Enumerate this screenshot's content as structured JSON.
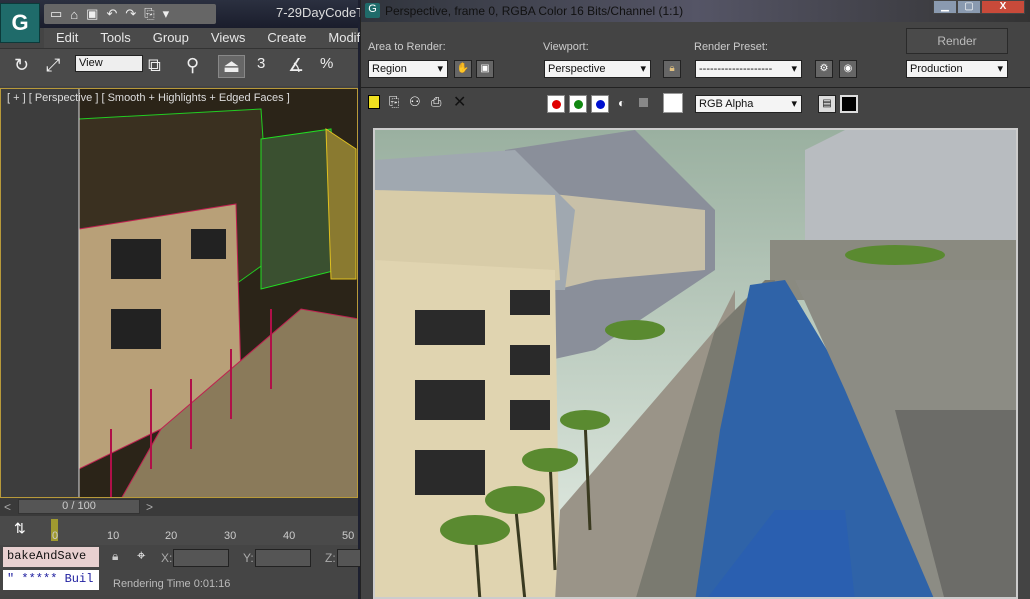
{
  "app": {
    "logo": "G",
    "document_title": "7-29DayCodeT",
    "quick_access": [
      "new-icon",
      "open-icon",
      "save-icon",
      "undo-icon",
      "redo-icon",
      "project-icon",
      "more-icon"
    ],
    "menu": [
      "Edit",
      "Tools",
      "Group",
      "Views",
      "Create",
      "Modifi"
    ],
    "toolbar": {
      "view_select": "View",
      "snap_label": "3",
      "percent_label": "%"
    },
    "viewport": {
      "label": "[ + ] [ Perspective ] [ Smooth + Highlights + Edged Faces ]"
    },
    "timeline": {
      "frame": "0 / 100",
      "prev": "<",
      "next": ">",
      "ticks": [
        "0",
        "10",
        "20",
        "30",
        "40",
        "50"
      ]
    },
    "script": {
      "listener_input": "bakeAndSave",
      "listener_output": "\" ***** Buil"
    },
    "coords": {
      "x_label": "X:",
      "y_label": "Y:",
      "z_label": "Z:"
    },
    "status": "Rendering Time  0:01:16"
  },
  "render_window": {
    "title": "Perspective, frame 0, RGBA Color 16 Bits/Channel (1:1)",
    "area_label": "Area to Render:",
    "area_value": "Region",
    "viewport_label": "Viewport:",
    "viewport_value": "Perspective",
    "preset_label": "Render Preset:",
    "preset_value": "--------------------",
    "render_button": "Render",
    "mode_value": "Production",
    "channel_value": "RGB Alpha",
    "colors": {
      "red": "#e00000",
      "green": "#118811",
      "blue": "#0010d0"
    }
  }
}
